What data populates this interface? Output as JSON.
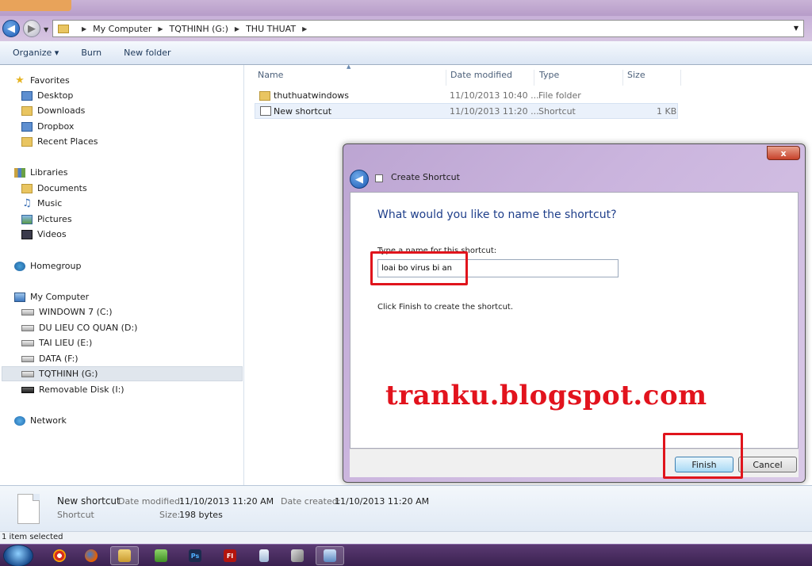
{
  "address": {
    "crumbs": [
      "My Computer",
      "TQTHINH (G:)",
      "THU THUAT"
    ]
  },
  "toolbar": {
    "organize_label": "Organize",
    "burn_label": "Burn",
    "new_folder_label": "New folder"
  },
  "nav": {
    "favorites": "Favorites",
    "desktop": "Desktop",
    "downloads": "Downloads",
    "dropbox": "Dropbox",
    "recent_places": "Recent Places",
    "libraries": "Libraries",
    "documents": "Documents",
    "music": "Music",
    "pictures": "Pictures",
    "videos": "Videos",
    "homegroup": "Homegroup",
    "my_computer": "My Computer",
    "drive_c": "WINDOWN 7 (C:)",
    "drive_d": "DU LIEU CO QUAN (D:)",
    "drive_e": "TAI LIEU (E:)",
    "drive_f": "DATA (F:)",
    "drive_g": "TQTHINH (G:)",
    "drive_i": "Removable Disk (I:)",
    "network": "Network"
  },
  "columns": {
    "name": "Name",
    "date_modified": "Date modified",
    "type": "Type",
    "size": "Size"
  },
  "files": [
    {
      "name": "thuthuatwindows",
      "date": "11/10/2013 10:40 ...",
      "type": "File folder",
      "size": ""
    },
    {
      "name": "New shortcut",
      "date": "11/10/2013 11:20 ...",
      "type": "Shortcut",
      "size": "1 KB"
    }
  ],
  "dialog": {
    "close_label": "x",
    "title": "Create Shortcut",
    "heading": "What would you like to name the shortcut?",
    "input_label": "Type a name for this shortcut:",
    "input_value": "loai bo virus bi an",
    "hint": "Click Finish to create the shortcut.",
    "watermark": "tranku.blogspot.com",
    "finish_label": "Finish",
    "cancel_label": "Cancel"
  },
  "details": {
    "name": "New shortcut",
    "type": "Shortcut",
    "date_modified_label": "Date modified:",
    "date_modified_value": "11/10/2013 11:20 AM",
    "date_created_label": "Date created:",
    "date_created_value": "11/10/2013 11:20 AM",
    "size_label": "Size:",
    "size_value": "198 bytes"
  },
  "status": {
    "text": "1 item selected"
  },
  "taskbar": {
    "apps": [
      "chrome",
      "firefox",
      "explorer",
      "app-green",
      "photoshop",
      "flash",
      "notepad",
      "tools",
      "window"
    ]
  }
}
